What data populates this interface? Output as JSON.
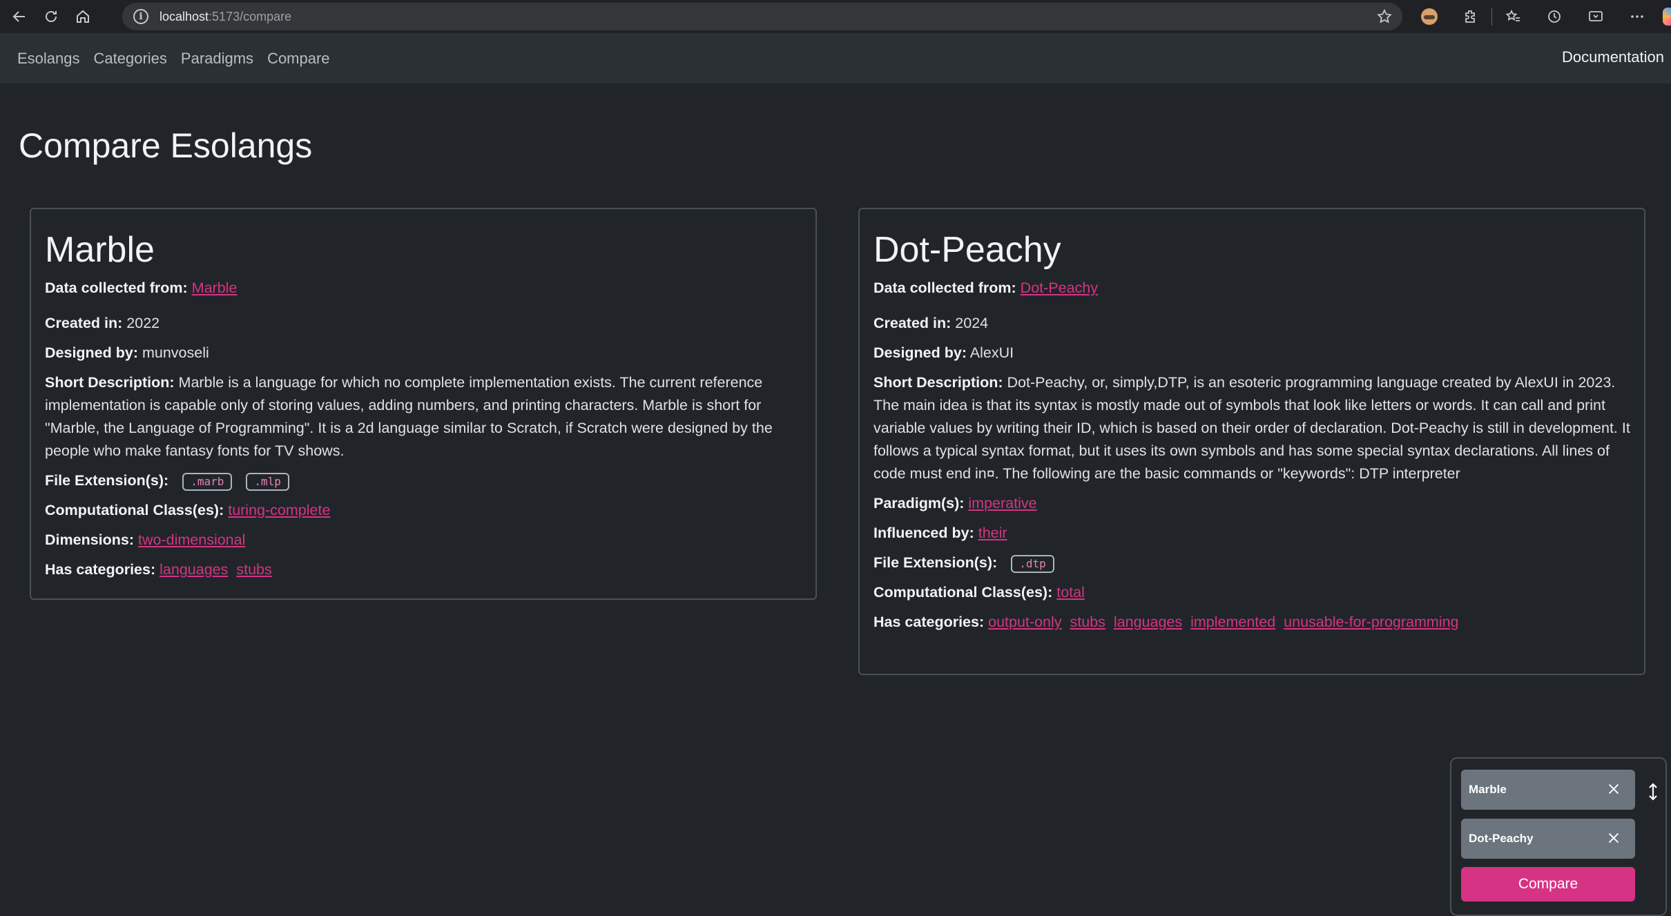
{
  "browser": {
    "url_host": "localhost",
    "url_path": ":5173/compare"
  },
  "nav": {
    "links": [
      "Esolangs",
      "Categories",
      "Paradigms",
      "Compare"
    ],
    "documentation": "Documentation"
  },
  "page_title": "Compare Esolangs",
  "labels": {
    "data_collected": "Data collected from:",
    "created": "Created in:",
    "designed": "Designed by:",
    "short_desc": "Short Description:",
    "file_ext": "File Extension(s):",
    "comp_class": "Computational Class(es):",
    "dimensions": "Dimensions:",
    "categories": "Has categories:",
    "paradigm": "Paradigm(s):",
    "influenced": "Influenced by:"
  },
  "left": {
    "name": "Marble",
    "source_link": "Marble",
    "created": "2022",
    "designed_by": "munvoseli",
    "description": "Marble is a language for which no complete implementation exists. The current reference implementation is capable only of storing values, adding numbers, and printing characters. Marble is short for \"Marble, the Language of Programming\". It is a 2d language similar to Scratch, if Scratch were designed by the people who make fantasy fonts for TV shows.",
    "extensions": [
      ".marb",
      ".mlp"
    ],
    "comp_class": [
      "turing-complete"
    ],
    "dimensions": [
      "two-dimensional"
    ],
    "categories": [
      "languages",
      "stubs"
    ]
  },
  "right": {
    "name": "Dot-Peachy",
    "source_link": "Dot-Peachy",
    "created": "2024",
    "designed_by": "AlexUI",
    "description": "Dot-Peachy, or, simply,DTP, is an esoteric programming language created by AlexUI in 2023. The main idea is that its syntax is mostly made out of symbols that look like letters or words. It can call and print variable values by writing their ID, which is based on their order of declaration. Dot-Peachy is still in development. It follows a typical syntax format, but it uses its own symbols and has some special syntax declarations. All lines of code must end in¤. The following are the basic commands or \"keywords\": DTP interpreter",
    "paradigms": [
      "imperative"
    ],
    "influenced_by": [
      "their"
    ],
    "extensions": [
      ".dtp"
    ],
    "comp_class": [
      "total"
    ],
    "categories": [
      "output-only",
      "stubs",
      "languages",
      "implemented",
      "unusable-for-programming"
    ]
  },
  "compare_panel": {
    "items": [
      "Marble",
      "Dot-Peachy"
    ],
    "button": "Compare"
  },
  "colors": {
    "accent": "#d63384",
    "background": "#212529",
    "navbar": "#2b3035"
  }
}
